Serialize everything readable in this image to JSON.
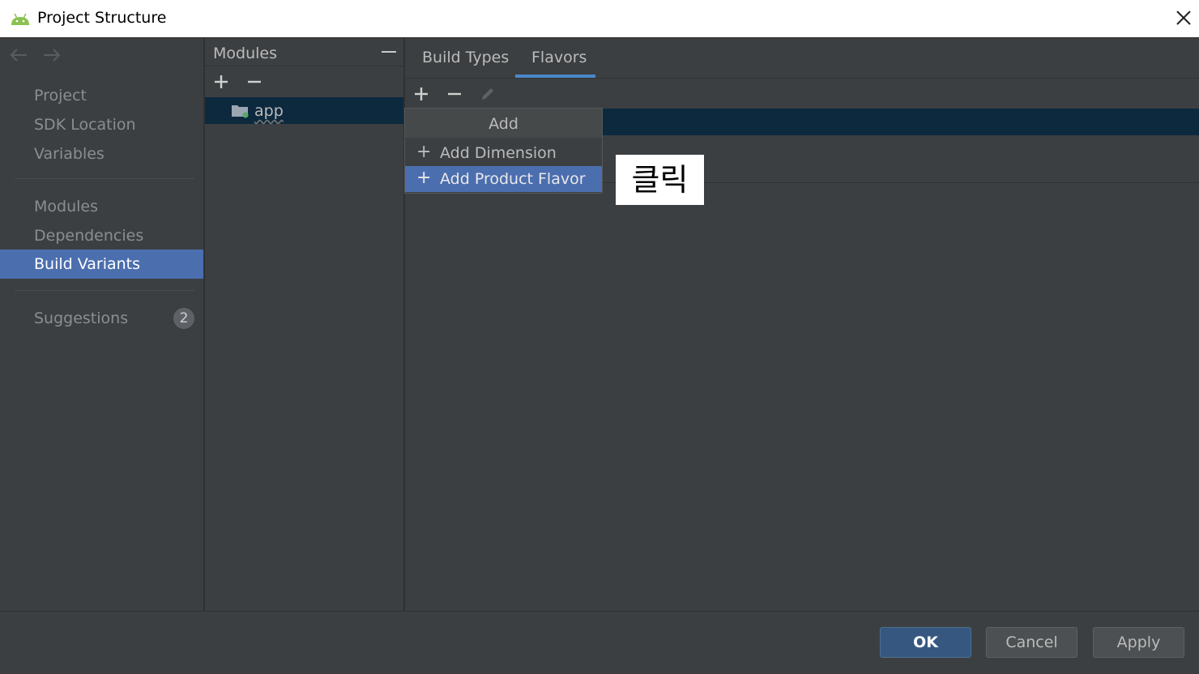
{
  "window": {
    "title": "Project Structure"
  },
  "nav": {
    "items": [
      {
        "label": "Project"
      },
      {
        "label": "SDK Location"
      },
      {
        "label": "Variables"
      },
      {
        "label": "Modules"
      },
      {
        "label": "Dependencies"
      },
      {
        "label": "Build Variants"
      },
      {
        "label": "Suggestions",
        "badge": "2"
      }
    ],
    "selected": "Build Variants"
  },
  "modules_panel": {
    "header": "Modules",
    "items": [
      {
        "label": "app"
      }
    ]
  },
  "main": {
    "tabs": [
      {
        "label": "Build Types"
      },
      {
        "label": "Flavors"
      }
    ],
    "active_tab": "Flavors"
  },
  "popup": {
    "title": "Add",
    "items": [
      {
        "icon": "+",
        "label": "Add Dimension"
      },
      {
        "icon": "+",
        "label": "Add Product Flavor"
      }
    ],
    "highlighted": "Add Product Flavor"
  },
  "annotation": {
    "text": "클릭"
  },
  "footer": {
    "ok": "OK",
    "cancel": "Cancel",
    "apply": "Apply"
  },
  "colors": {
    "accent": "#4b6eaf",
    "tab_underline": "#4a88c7",
    "background": "#3c3f41",
    "selection_row": "#0d293e"
  }
}
